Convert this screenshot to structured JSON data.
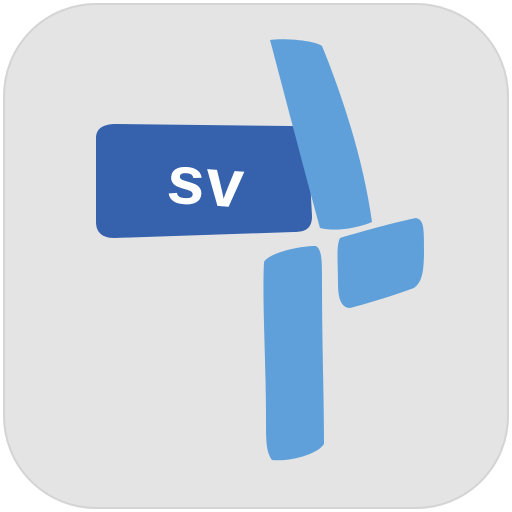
{
  "app_icon": {
    "label": "sv",
    "colors": {
      "background": "#e4e4e5",
      "badge": "#3561ad",
      "cross": "#5fa0da"
    }
  }
}
